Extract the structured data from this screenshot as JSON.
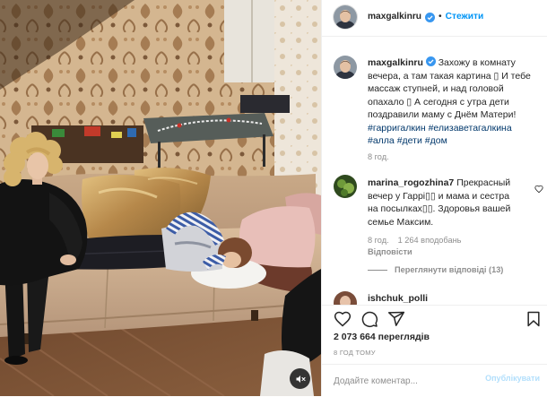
{
  "header": {
    "username": "maxgalkinru",
    "separator": "•",
    "follow_label": "Стежити"
  },
  "caption": {
    "username": "maxgalkinru",
    "text": "Захожу в комнату вечера, а там такая картина ▯ И тебе массаж ступней, и над головой опахало ▯ А сегодня с утра дети поздравили маму с Днём Матери!",
    "hashtags": [
      "#гарригалкин",
      "#елизаветагалкина",
      "#алла",
      "#дети",
      "#дом"
    ],
    "time": "8 год."
  },
  "comments": [
    {
      "username": "marina_rogozhina7",
      "text": "Прекрасный вечер у Гаррі▯▯ и мама и сестра на посылках▯▯. Здоровья вашей семье Максим.",
      "time": "8 год.",
      "likes": "1 264 вподобань",
      "reply_label": "Відповісти",
      "view_replies_label": "Переглянути відповіді (13)"
    },
    {
      "username": "ishchuk_polli"
    }
  ],
  "views": "2 073 664 переглядів",
  "posted_ago": "8 ГОД ТОМУ",
  "comment_input": {
    "placeholder": "Додайте коментар...",
    "submit_label": "Опублікувати"
  },
  "icons": {
    "verified": "verified-badge-icon",
    "like": "heart-icon",
    "comment": "comment-icon",
    "share": "send-icon",
    "save": "bookmark-icon",
    "comment_like": "heart-icon",
    "mute": "speaker-muted-icon"
  },
  "colors": {
    "link": "#0095f6",
    "hashtag": "#00376b",
    "muted": "#8e8e8e",
    "submit_disabled": "#b2dffc",
    "verified": "#3897f0"
  }
}
